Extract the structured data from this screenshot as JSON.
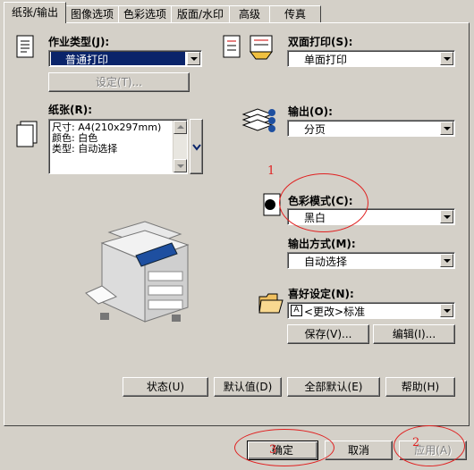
{
  "tabs": [
    {
      "label": "纸张/输出",
      "active": true
    },
    {
      "label": "图像选项",
      "active": false
    },
    {
      "label": "色彩选项",
      "active": false
    },
    {
      "label": "版面/水印",
      "active": false
    },
    {
      "label": "高级",
      "active": false
    },
    {
      "label": "传真",
      "active": false
    }
  ],
  "job_type": {
    "label": "作业类型(J):",
    "key": "J",
    "value": "普通打印",
    "settings_button": "设定(T)..."
  },
  "paper": {
    "label": "纸张(R):",
    "lines": [
      "尺寸: A4(210x297mm)",
      "颜色: 白色",
      "类型: 自动选择"
    ]
  },
  "duplex": {
    "label": "双面打印(S):",
    "value": "单面打印"
  },
  "output": {
    "label": "输出(O):",
    "value": "分页"
  },
  "color_mode": {
    "label": "色彩模式(C):",
    "value": "黑白"
  },
  "output_method": {
    "label": "输出方式(M):",
    "value": "自动选择"
  },
  "favorites": {
    "label": "喜好设定(N):",
    "value": "<更改>标准",
    "save_button": "保存(V)...",
    "edit_button": "编辑(I)..."
  },
  "bottom_row": {
    "status": "状态(U)",
    "defaults": "默认值(D)",
    "all_defaults": "全部默认(E)",
    "help": "帮助(H)"
  },
  "dialog_buttons": {
    "ok": "确定",
    "cancel": "取消",
    "apply": "应用(A)"
  },
  "annotations": {
    "n1": "1",
    "n2": "2",
    "n3": "3"
  },
  "colors": {
    "annotation_red": "#e02020",
    "selection_blue": "#0a246a"
  }
}
